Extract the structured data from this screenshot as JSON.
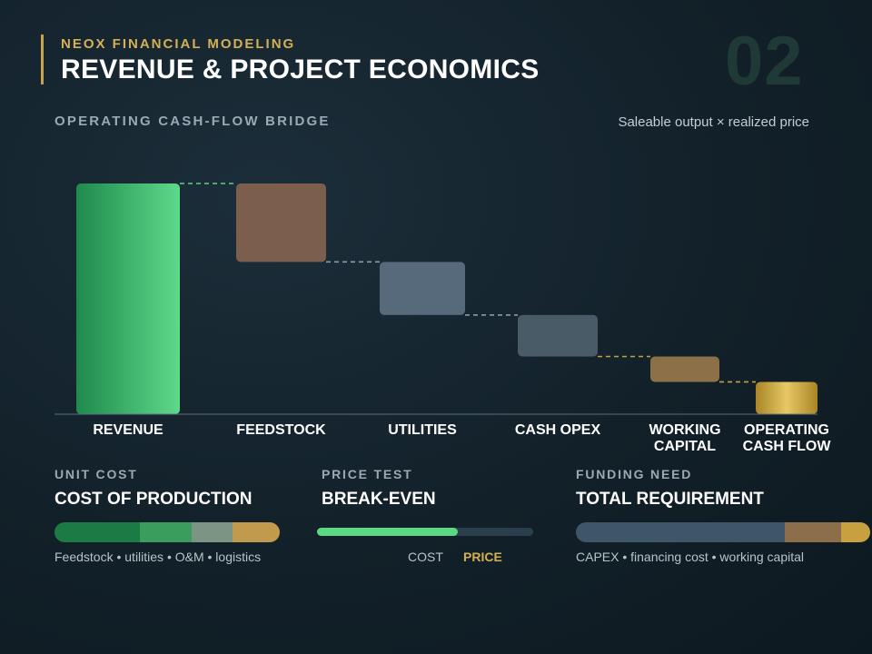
{
  "header": {
    "eyebrow": "NEOX FINANCIAL MODELING",
    "title": "REVENUE & PROJECT ECONOMICS",
    "page_number": "02"
  },
  "section": {
    "label": "OPERATING CASH-FLOW BRIDGE",
    "note": "Saleable output × realized price"
  },
  "chart_data": {
    "type": "bar",
    "subtype": "waterfall",
    "title": "OPERATING CASH-FLOW BRIDGE",
    "categories": [
      "REVENUE",
      "FEEDSTOCK",
      "UTILITIES",
      "CASH OPEX",
      "WORKING CAPITAL",
      "OPERATING CASH FLOW"
    ],
    "category_lines": [
      [
        "REVENUE"
      ],
      [
        "FEEDSTOCK"
      ],
      [
        "UTILITIES"
      ],
      [
        "CASH OPEX"
      ],
      [
        "WORKING",
        "CAPITAL"
      ],
      [
        "OPERATING",
        "CASH FLOW"
      ]
    ],
    "values": [
      100,
      -34,
      -23,
      -18,
      -11,
      14
    ],
    "kinds": [
      "total",
      "decrease",
      "decrease",
      "decrease",
      "decrease",
      "total"
    ],
    "ylim": [
      0,
      100
    ],
    "grid": false,
    "colors": [
      "#3fbf6e",
      "#7b5f4c",
      "#566a7b",
      "#4a5b68",
      "#8c7048",
      "#c9a23e"
    ]
  },
  "panels": {
    "unit_cost": {
      "kicker": "UNIT COST",
      "heading": "COST OF PRODUCTION",
      "caption": "Feedstock • utilities • O&M • logistics",
      "shares": [
        0.38,
        0.23,
        0.18,
        0.21
      ],
      "colors": [
        "#1c7a45",
        "#3a9d5e",
        "#7c9484",
        "#c19a4e"
      ]
    },
    "price_test": {
      "kicker": "PRICE TEST",
      "heading": "BREAK-EVEN",
      "cost_label": "COST",
      "price_label": "PRICE",
      "fill_fraction": 0.65,
      "colors": [
        "#5ad884",
        "#2a3f4b"
      ]
    },
    "funding_need": {
      "kicker": "FUNDING NEED",
      "heading": "TOTAL REQUIREMENT",
      "caption": "CAPEX • financing cost • working capital",
      "shares": [
        0.71,
        0.19,
        0.1
      ],
      "colors": [
        "#3f5668",
        "#8c6f4a",
        "#c9a040"
      ]
    }
  }
}
